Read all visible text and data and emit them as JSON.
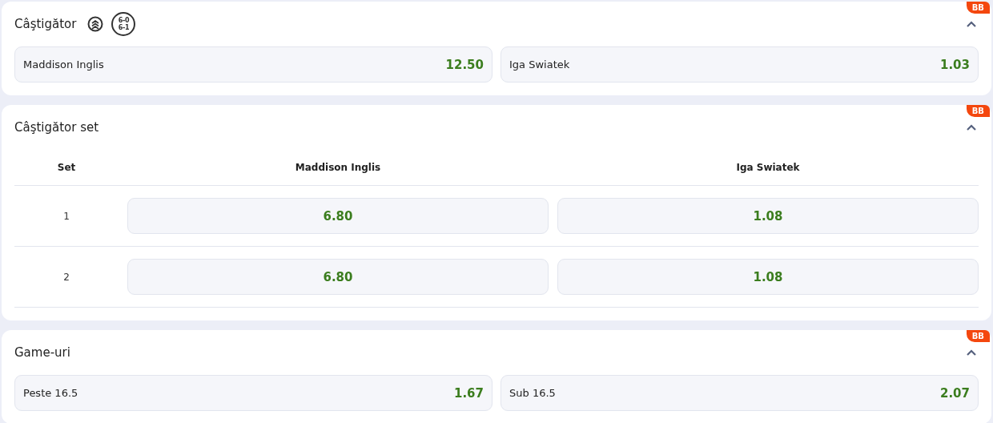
{
  "markets": [
    {
      "kind": "simple",
      "title": "Câştigător",
      "badge": "BB",
      "expanded": true,
      "icons": [
        {
          "kind": "boost"
        },
        {
          "kind": "score",
          "lines": [
            "6-0",
            "6-1"
          ]
        }
      ],
      "outcomes": [
        {
          "label": "Maddison Inglis",
          "odds": "12.50"
        },
        {
          "label": "Iga Swiatek",
          "odds": "1.03"
        }
      ]
    },
    {
      "kind": "table",
      "title": "Câştigător set",
      "badge": "BB",
      "expanded": true,
      "columns": [
        "Set",
        "Maddison Inglis",
        "Iga Swiatek"
      ],
      "rows": [
        {
          "label": "1",
          "odds": [
            "6.80",
            "1.08"
          ]
        },
        {
          "label": "2",
          "odds": [
            "6.80",
            "1.08"
          ]
        }
      ]
    },
    {
      "kind": "simple",
      "title": "Game-uri",
      "badge": "BB",
      "expanded": true,
      "outcomes": [
        {
          "label": "Peste 16.5",
          "odds": "1.67"
        },
        {
          "label": "Sub 16.5",
          "odds": "2.07"
        }
      ]
    }
  ]
}
